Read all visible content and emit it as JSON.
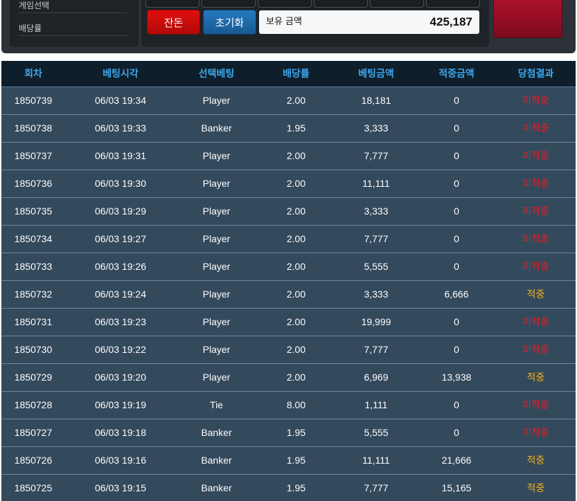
{
  "side_menu": {
    "items": [
      {
        "label": "게임선택"
      },
      {
        "label": "배당률"
      }
    ]
  },
  "controls": {
    "balance_button": "잔돈",
    "reset_button": "초기화",
    "hold_label": "보유 금액",
    "hold_amount": "425,187"
  },
  "colors": {
    "header_bg": "#0f1e2b",
    "header_text": "#3ea6ea",
    "row_bg": "#33495c",
    "miss": "#e0202a",
    "hit": "#f2b21e"
  },
  "table": {
    "headers": [
      "회차",
      "베팅시각",
      "선택베팅",
      "배당률",
      "베팅금액",
      "적중금액",
      "당첨결과"
    ],
    "rows": [
      {
        "round": "1850739",
        "time": "06/03 19:34",
        "pick": "Player",
        "odds": "2.00",
        "bet": "18,181",
        "win": "0",
        "result": "미적중",
        "hit": false
      },
      {
        "round": "1850738",
        "time": "06/03 19:33",
        "pick": "Banker",
        "odds": "1.95",
        "bet": "3,333",
        "win": "0",
        "result": "미적중",
        "hit": false
      },
      {
        "round": "1850737",
        "time": "06/03 19:31",
        "pick": "Player",
        "odds": "2.00",
        "bet": "7,777",
        "win": "0",
        "result": "미적중",
        "hit": false
      },
      {
        "round": "1850736",
        "time": "06/03 19:30",
        "pick": "Player",
        "odds": "2.00",
        "bet": "11,111",
        "win": "0",
        "result": "미적중",
        "hit": false
      },
      {
        "round": "1850735",
        "time": "06/03 19:29",
        "pick": "Player",
        "odds": "2.00",
        "bet": "3,333",
        "win": "0",
        "result": "미적중",
        "hit": false
      },
      {
        "round": "1850734",
        "time": "06/03 19:27",
        "pick": "Player",
        "odds": "2.00",
        "bet": "7,777",
        "win": "0",
        "result": "미적중",
        "hit": false
      },
      {
        "round": "1850733",
        "time": "06/03 19:26",
        "pick": "Player",
        "odds": "2.00",
        "bet": "5,555",
        "win": "0",
        "result": "미적중",
        "hit": false
      },
      {
        "round": "1850732",
        "time": "06/03 19:24",
        "pick": "Player",
        "odds": "2.00",
        "bet": "3,333",
        "win": "6,666",
        "result": "적중",
        "hit": true
      },
      {
        "round": "1850731",
        "time": "06/03 19:23",
        "pick": "Player",
        "odds": "2.00",
        "bet": "19,999",
        "win": "0",
        "result": "미적중",
        "hit": false
      },
      {
        "round": "1850730",
        "time": "06/03 19:22",
        "pick": "Player",
        "odds": "2.00",
        "bet": "7,777",
        "win": "0",
        "result": "미적중",
        "hit": false
      },
      {
        "round": "1850729",
        "time": "06/03 19:20",
        "pick": "Player",
        "odds": "2.00",
        "bet": "6,969",
        "win": "13,938",
        "result": "적중",
        "hit": true
      },
      {
        "round": "1850728",
        "time": "06/03 19:19",
        "pick": "Tie",
        "odds": "8.00",
        "bet": "1,111",
        "win": "0",
        "result": "미적중",
        "hit": false
      },
      {
        "round": "1850727",
        "time": "06/03 19:18",
        "pick": "Banker",
        "odds": "1.95",
        "bet": "5,555",
        "win": "0",
        "result": "미적중",
        "hit": false
      },
      {
        "round": "1850726",
        "time": "06/03 19:16",
        "pick": "Banker",
        "odds": "1.95",
        "bet": "11,111",
        "win": "21,666",
        "result": "적중",
        "hit": true
      },
      {
        "round": "1850725",
        "time": "06/03 19:15",
        "pick": "Banker",
        "odds": "1.95",
        "bet": "7,777",
        "win": "15,165",
        "result": "적중",
        "hit": true
      }
    ]
  }
}
